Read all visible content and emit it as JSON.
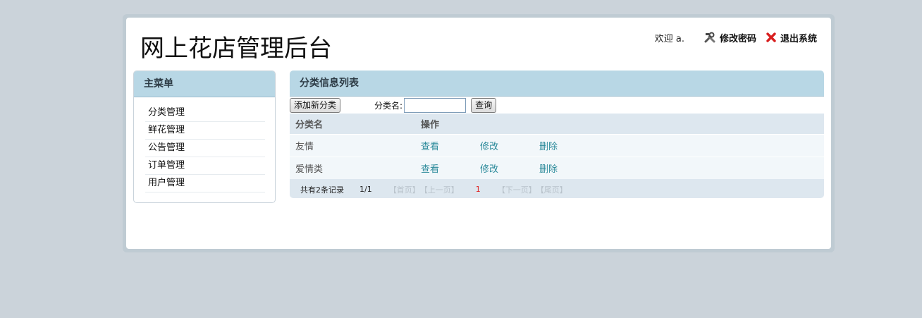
{
  "header": {
    "title": "网上花店管理后台",
    "welcome": "欢迎 a.",
    "change_password": "修改密码",
    "logout": "退出系统"
  },
  "sidebar": {
    "title": "主菜单",
    "items": [
      {
        "label": "分类管理"
      },
      {
        "label": "鲜花管理"
      },
      {
        "label": "公告管理"
      },
      {
        "label": "订单管理"
      },
      {
        "label": "用户管理"
      }
    ]
  },
  "main": {
    "title": "分类信息列表",
    "add_button": "添加新分类",
    "search_label": "分类名:",
    "search_value": "",
    "search_button": "查询",
    "columns": [
      "分类名",
      "操作"
    ],
    "rows": [
      {
        "name": "友情",
        "view": "查看",
        "edit": "修改",
        "delete": "删除"
      },
      {
        "name": "爱情类",
        "view": "查看",
        "edit": "修改",
        "delete": "删除"
      }
    ],
    "pager": {
      "total": "共有2条记录",
      "pages": "1/1",
      "first": "【首页】",
      "prev": "【上一页】",
      "current": "1",
      "next": "【下一页】",
      "last": "【尾页】"
    }
  }
}
